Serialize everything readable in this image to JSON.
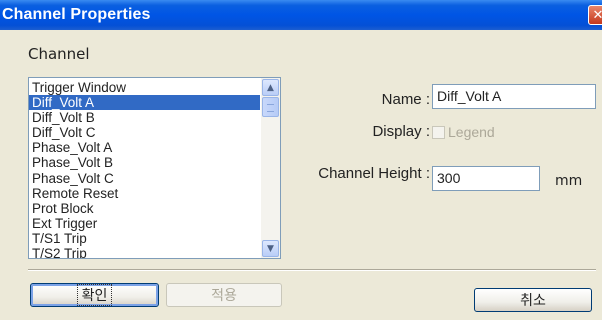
{
  "window": {
    "title": "Channel Properties",
    "close_glyph": "✕"
  },
  "channel_section": {
    "label": "Channel"
  },
  "channel_list": {
    "items": [
      "Trigger Window",
      "Diff_Volt A",
      "Diff_Volt B",
      "Diff_Volt C",
      "Phase_Volt A",
      "Phase_Volt B",
      "Phase_Volt C",
      "Remote Reset",
      "Prot Block",
      "Ext Trigger",
      "T/S1 Trip",
      "T/S2 Trip"
    ],
    "selected_index": 1,
    "scroll_up_icon": "▲",
    "scroll_down_icon": "▼"
  },
  "fields": {
    "name_label": "Name :",
    "name_value": "Diff_Volt A",
    "display_label": "Display :",
    "legend_label": "Legend",
    "legend_checked": false,
    "height_label": "Channel Height :",
    "height_value": "300",
    "height_unit": "mm"
  },
  "buttons": {
    "ok_label": "확인",
    "apply_label": "적용",
    "cancel_label": "취소"
  },
  "colors": {
    "titlebar": "#0055E5",
    "selection": "#316AC5",
    "dialog_bg": "#ECE9D8"
  }
}
